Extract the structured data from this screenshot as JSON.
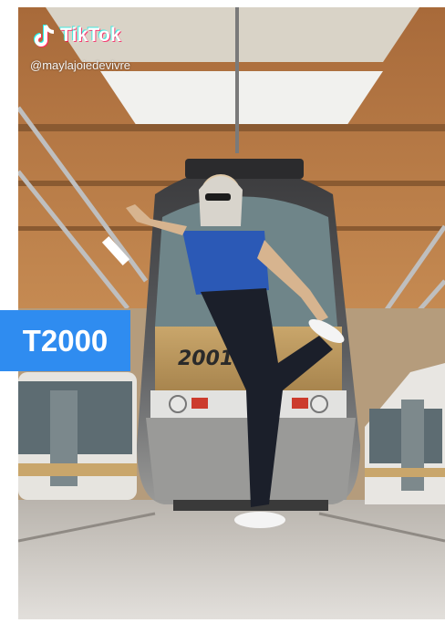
{
  "app": {
    "logo_text": "TikTok",
    "handle": "@maylajoiedevivre"
  },
  "overlay": {
    "label": "T2000",
    "label_bg": "#2f8cf0"
  },
  "scene": {
    "tram_number": "2001"
  },
  "icons": {
    "logo": "tiktok-note-icon"
  }
}
